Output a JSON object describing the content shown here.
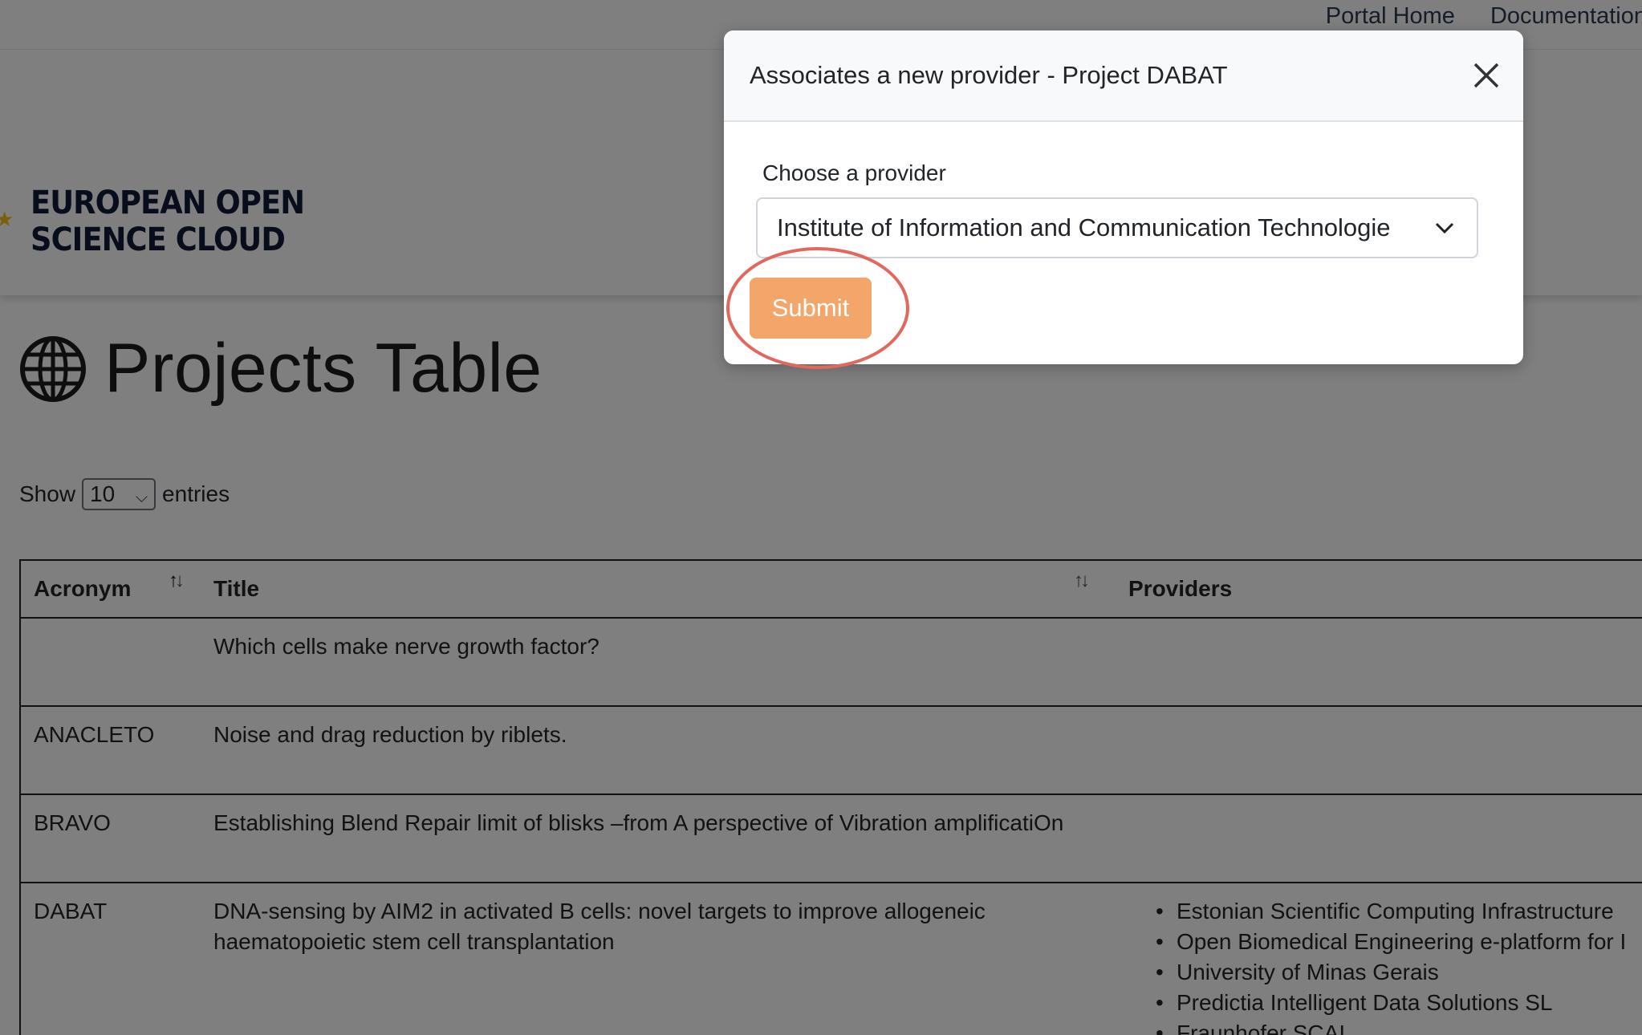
{
  "topnav": {
    "links": [
      "Portal Home",
      "Documentation"
    ]
  },
  "logo": {
    "line1": "EUROPEAN OPEN",
    "line2": "SCIENCE CLOUD"
  },
  "page": {
    "title": "Projects Table"
  },
  "length_control": {
    "show_label": "Show",
    "selected": "10",
    "entries_label": "entries"
  },
  "table": {
    "headers": {
      "acronym": "Acronym",
      "title": "Title",
      "providers": "Providers"
    },
    "rows": [
      {
        "acronym": "",
        "title": "Which cells make nerve growth factor?",
        "providers": []
      },
      {
        "acronym": "ANACLETO",
        "title": "Noise and drag reduction by riblets.",
        "providers": []
      },
      {
        "acronym": "BRAVO",
        "title": "Establishing Blend Repair limit of blisks –from A perspective of Vibration amplificatiOn",
        "providers": []
      },
      {
        "acronym": "DABAT",
        "title": "DNA-sensing by AIM2 in activated B cells: novel targets to improve allogeneic haematopoietic stem cell transplantation",
        "providers": [
          "Estonian Scientific Computing Infrastructure",
          "Open Biomedical Engineering e-platform for I",
          "University of Minas Gerais",
          "Predictia Intelligent Data Solutions SL",
          "Fraunhofer SCAI"
        ]
      }
    ]
  },
  "modal": {
    "title": "Associates a new provider - Project DABAT",
    "field_label": "Choose a provider",
    "selected_provider": "Institute of Information and Communication Technologie",
    "submit_label": "Submit"
  },
  "colors": {
    "submit": "#f4a66a",
    "highlight": "#e2675c",
    "backdrop": "rgba(0,0,0,0.5)"
  }
}
